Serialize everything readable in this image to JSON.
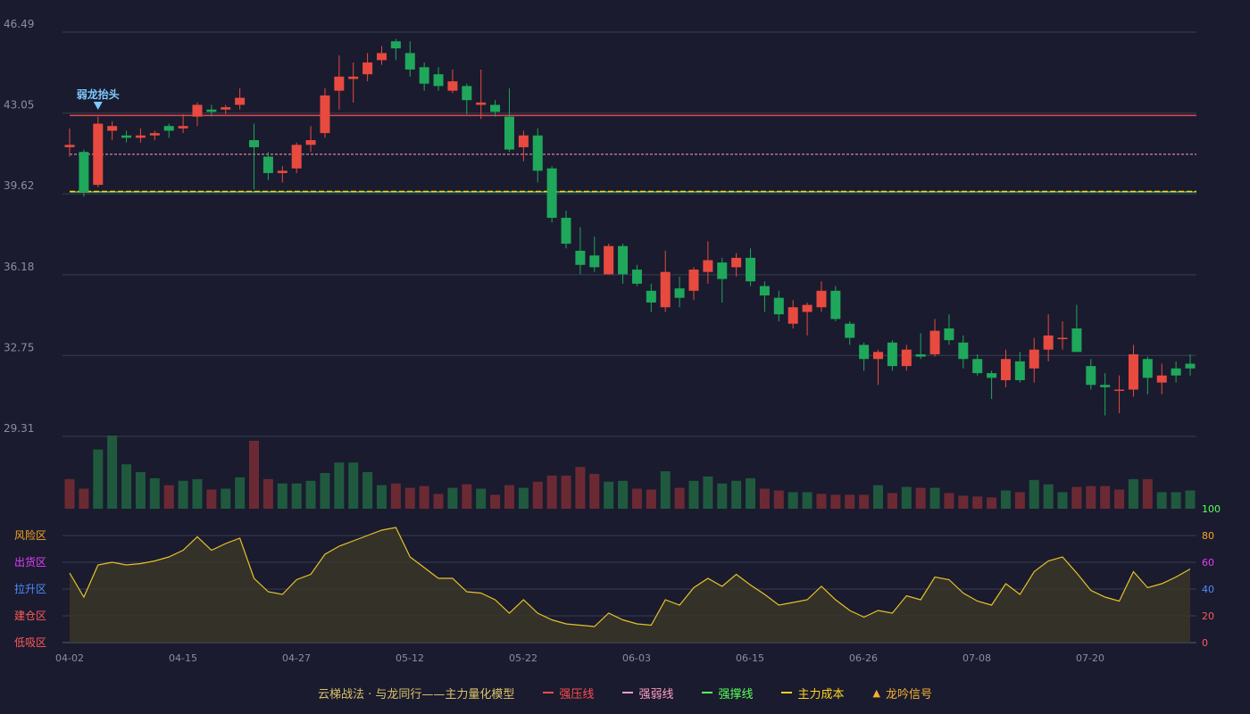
{
  "legend": {
    "title": "云梯战法 · 与龙同行——主力量化模型",
    "items": [
      {
        "label": "强压线",
        "color": "#ff4d4f",
        "style": "solid",
        "icon": "line-icon"
      },
      {
        "label": "强弱线",
        "color": "#ff9ec4",
        "style": "dash",
        "icon": "dash-line-icon"
      },
      {
        "label": "强撑线",
        "color": "#5cff5c",
        "style": "solid",
        "icon": "line-icon"
      },
      {
        "label": "主力成本",
        "color": "#ffd21f",
        "style": "dash",
        "icon": "dash-line-icon"
      },
      {
        "label": "龙吟信号",
        "color": "#f5b031",
        "style": "triangle",
        "icon": "triangle-icon"
      }
    ]
  },
  "colors": {
    "background": "#1a1b2e",
    "up": "#e84a3f",
    "down": "#1fa75b",
    "grid": "#3a3c50",
    "axis_text": "#8c8ea0",
    "osc_line": "#e6c229"
  },
  "chart_data": {
    "type": "candlestick",
    "x_ticks": [
      "04-02",
      "04-15",
      "04-27",
      "05-12",
      "05-22",
      "06-03",
      "06-15",
      "06-26",
      "07-08",
      "07-20"
    ],
    "y_ticks": [
      "46.49",
      "43.05",
      "39.62",
      "36.18",
      "32.75",
      "29.31"
    ],
    "ylim": [
      29.31,
      46.49
    ],
    "ohlc": [
      [
        41.6,
        41.7,
        42.4,
        41.2
      ],
      [
        41.4,
        39.7,
        41.5,
        39.5
      ],
      [
        40.0,
        42.6,
        42.9,
        39.9
      ],
      [
        42.3,
        42.5,
        42.7,
        41.9
      ],
      [
        42.1,
        42.0,
        42.3,
        41.8
      ],
      [
        42.0,
        42.1,
        42.4,
        41.8
      ],
      [
        42.1,
        42.2,
        42.3,
        41.9
      ],
      [
        42.5,
        42.3,
        42.6,
        42.0
      ],
      [
        42.4,
        42.5,
        43.0,
        42.2
      ],
      [
        42.9,
        43.4,
        43.5,
        42.5
      ],
      [
        43.2,
        43.1,
        43.4,
        42.9
      ],
      [
        43.2,
        43.3,
        43.4,
        43.0
      ],
      [
        43.4,
        43.7,
        44.1,
        43.2
      ],
      [
        41.9,
        41.6,
        42.6,
        39.8
      ],
      [
        41.2,
        40.5,
        41.4,
        40.2
      ],
      [
        40.5,
        40.6,
        40.8,
        40.1
      ],
      [
        40.7,
        41.7,
        41.8,
        40.5
      ],
      [
        41.7,
        41.9,
        42.5,
        41.4
      ],
      [
        42.2,
        43.8,
        44.1,
        42.0
      ],
      [
        44.0,
        44.6,
        45.5,
        43.2
      ],
      [
        44.5,
        44.6,
        45.2,
        43.5
      ],
      [
        44.7,
        45.2,
        45.6,
        44.4
      ],
      [
        45.3,
        45.6,
        45.9,
        45.1
      ],
      [
        46.1,
        45.8,
        46.2,
        45.3
      ],
      [
        45.6,
        44.9,
        46.1,
        44.6
      ],
      [
        45.0,
        44.3,
        45.2,
        44.0
      ],
      [
        44.7,
        44.2,
        45.0,
        44.0
      ],
      [
        44.0,
        44.4,
        44.9,
        43.9
      ],
      [
        44.2,
        43.6,
        44.3,
        43.0
      ],
      [
        43.4,
        43.5,
        44.9,
        42.8
      ],
      [
        43.4,
        43.1,
        43.6,
        42.9
      ],
      [
        42.9,
        41.5,
        44.1,
        41.4
      ],
      [
        41.6,
        42.1,
        42.3,
        41.0
      ],
      [
        42.1,
        40.6,
        42.4,
        40.1
      ],
      [
        40.7,
        38.6,
        40.8,
        38.4
      ],
      [
        38.6,
        37.5,
        38.9,
        37.3
      ],
      [
        37.2,
        36.6,
        38.2,
        36.2
      ],
      [
        37.0,
        36.5,
        37.8,
        36.3
      ],
      [
        36.2,
        37.4,
        37.5,
        36.2
      ],
      [
        37.4,
        36.2,
        37.5,
        35.8
      ],
      [
        36.4,
        35.8,
        36.6,
        35.7
      ],
      [
        35.5,
        35.0,
        35.8,
        34.6
      ],
      [
        34.8,
        36.3,
        37.2,
        34.6
      ],
      [
        35.6,
        35.2,
        36.1,
        34.8
      ],
      [
        35.5,
        36.4,
        36.5,
        35.1
      ],
      [
        36.3,
        36.8,
        37.6,
        35.8
      ],
      [
        36.7,
        36.0,
        36.9,
        35.0
      ],
      [
        36.5,
        36.9,
        37.1,
        36.1
      ],
      [
        36.9,
        35.9,
        37.3,
        35.7
      ],
      [
        35.7,
        35.3,
        35.9,
        34.6
      ],
      [
        35.2,
        34.5,
        35.5,
        34.2
      ],
      [
        34.1,
        34.8,
        35.1,
        33.9
      ],
      [
        34.6,
        34.9,
        35.0,
        33.6
      ],
      [
        34.8,
        35.5,
        35.9,
        34.6
      ],
      [
        35.5,
        34.3,
        35.7,
        34.2
      ],
      [
        34.1,
        33.5,
        34.2,
        33.2
      ],
      [
        33.2,
        32.6,
        33.3,
        32.1
      ],
      [
        32.6,
        32.9,
        33.0,
        31.5
      ],
      [
        33.3,
        32.3,
        33.4,
        32.1
      ],
      [
        32.3,
        33.0,
        33.2,
        32.1
      ],
      [
        32.8,
        32.7,
        33.7,
        32.6
      ],
      [
        32.8,
        33.8,
        34.3,
        32.7
      ],
      [
        33.9,
        33.4,
        34.5,
        33.2
      ],
      [
        33.3,
        32.6,
        33.6,
        32.2
      ],
      [
        32.6,
        32.0,
        32.8,
        31.9
      ],
      [
        32.0,
        31.8,
        32.1,
        30.9
      ],
      [
        31.7,
        32.6,
        33.0,
        31.4
      ],
      [
        32.5,
        31.7,
        32.9,
        31.6
      ],
      [
        32.2,
        33.0,
        33.5,
        31.6
      ],
      [
        33.0,
        33.6,
        34.5,
        32.5
      ],
      [
        33.5,
        33.5,
        34.2,
        33.0
      ],
      [
        33.9,
        32.9,
        34.9,
        33.0
      ],
      [
        32.3,
        31.5,
        32.6,
        31.3
      ],
      [
        31.5,
        31.4,
        32.0,
        30.2
      ],
      [
        31.3,
        31.3,
        31.9,
        30.3
      ],
      [
        31.3,
        32.8,
        33.2,
        31.0
      ],
      [
        32.6,
        31.8,
        32.7,
        31.1
      ],
      [
        31.6,
        31.9,
        32.4,
        31.1
      ],
      [
        32.2,
        31.9,
        32.5,
        31.6
      ],
      [
        32.4,
        32.2,
        32.8,
        31.9
      ]
    ],
    "volume": [
      [
        "up",
        34
      ],
      [
        "up",
        23
      ],
      [
        "down",
        68
      ],
      [
        "down",
        84
      ],
      [
        "down",
        51
      ],
      [
        "down",
        42
      ],
      [
        "down",
        35
      ],
      [
        "up",
        27
      ],
      [
        "down",
        32
      ],
      [
        "down",
        34
      ],
      [
        "up",
        22
      ],
      [
        "down",
        23
      ],
      [
        "down",
        36
      ],
      [
        "up",
        78
      ],
      [
        "up",
        34
      ],
      [
        "down",
        29
      ],
      [
        "down",
        29
      ],
      [
        "down",
        32
      ],
      [
        "down",
        41
      ],
      [
        "down",
        53
      ],
      [
        "down",
        53
      ],
      [
        "down",
        42
      ],
      [
        "down",
        27
      ],
      [
        "up",
        29
      ],
      [
        "up",
        24
      ],
      [
        "up",
        26
      ],
      [
        "up",
        17
      ],
      [
        "down",
        24
      ],
      [
        "up",
        28
      ],
      [
        "down",
        23
      ],
      [
        "up",
        16
      ],
      [
        "up",
        27
      ],
      [
        "down",
        24
      ],
      [
        "up",
        31
      ],
      [
        "up",
        38
      ],
      [
        "up",
        38
      ],
      [
        "up",
        48
      ],
      [
        "up",
        40
      ],
      [
        "down",
        31
      ],
      [
        "down",
        32
      ],
      [
        "up",
        23
      ],
      [
        "up",
        22
      ],
      [
        "down",
        43
      ],
      [
        "up",
        24
      ],
      [
        "down",
        32
      ],
      [
        "down",
        37
      ],
      [
        "down",
        29
      ],
      [
        "down",
        32
      ],
      [
        "down",
        35
      ],
      [
        "up",
        23
      ],
      [
        "up",
        21
      ],
      [
        "down",
        19
      ],
      [
        "down",
        19
      ],
      [
        "up",
        17
      ],
      [
        "up",
        16
      ],
      [
        "up",
        16
      ],
      [
        "up",
        16
      ],
      [
        "down",
        27
      ],
      [
        "up",
        18
      ],
      [
        "down",
        25
      ],
      [
        "up",
        24
      ],
      [
        "down",
        24
      ],
      [
        "up",
        18
      ],
      [
        "up",
        15
      ],
      [
        "up",
        14
      ],
      [
        "up",
        13
      ],
      [
        "down",
        21
      ],
      [
        "up",
        19
      ],
      [
        "down",
        33
      ],
      [
        "down",
        28
      ],
      [
        "down",
        19
      ],
      [
        "up",
        25
      ],
      [
        "up",
        26
      ],
      [
        "up",
        26
      ],
      [
        "up",
        22
      ],
      [
        "down",
        34
      ],
      [
        "up",
        34
      ],
      [
        "down",
        19
      ],
      [
        "down",
        19
      ],
      [
        "down",
        21
      ]
    ],
    "oscillator": {
      "ylim": [
        0,
        100
      ],
      "zones": [
        "风险区",
        "出货区",
        "拉升区",
        "建仓区",
        "低吸区"
      ],
      "zone_colors": [
        "#f5a623",
        "#e040fb",
        "#4d8cff",
        "#ff5a5a",
        "#ff5a5a"
      ],
      "right_ticks": [
        "100",
        "80",
        "60",
        "40",
        "20",
        "0"
      ],
      "right_tick_colors": [
        "#5cff5c",
        "#f5a623",
        "#e040fb",
        "#4d8cff",
        "#ff5a5a",
        "#ff5a5a"
      ],
      "values": [
        52,
        34,
        58,
        60,
        58,
        59,
        61,
        64,
        69,
        79,
        69,
        74,
        78,
        48,
        38,
        36,
        47,
        51,
        66,
        72,
        76,
        80,
        84,
        86,
        64,
        56,
        48,
        48,
        38,
        37,
        32,
        22,
        32,
        22,
        17,
        14,
        13,
        12,
        22,
        17,
        14,
        13,
        32,
        28,
        41,
        48,
        42,
        51,
        43,
        36,
        28,
        30,
        32,
        42,
        32,
        24,
        19,
        24,
        22,
        35,
        32,
        49,
        47,
        37,
        31,
        28,
        44,
        36,
        53,
        61,
        64,
        52,
        39,
        34,
        31,
        53,
        41,
        44,
        49,
        55
      ]
    },
    "lines": {
      "resistance": 42.95,
      "weak_line": 41.3,
      "support": 39.7,
      "main_cost": 39.72
    },
    "signal": {
      "label": "弱龙抬头",
      "index": 2
    }
  }
}
